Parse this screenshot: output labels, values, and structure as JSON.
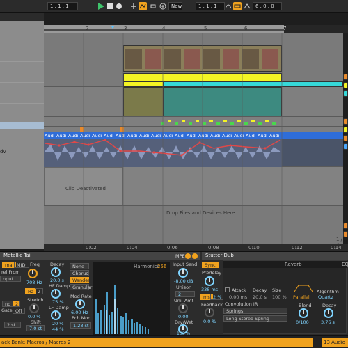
{
  "transport": {
    "arrangement_position": "1 .   1 .   1",
    "new_label": "New",
    "loop_start": "1 .   1 .   1",
    "loop_length": "6 .   0 .   0"
  },
  "ruler": {
    "bar_labels": [
      "2",
      "3",
      "4",
      "5",
      "6",
      "7"
    ]
  },
  "arrangement": {
    "clip_deactivated_label": "Clip Deactivated",
    "drop_label": "Drop Files and Devices Here",
    "audio_clip_label": "Audi",
    "audio_clip_labels": [
      "Audi",
      "Audi",
      "Audi",
      "Audi",
      "Audi",
      "Audi",
      "Audi",
      "Audi",
      "Audi",
      "Audi",
      "Audi",
      "Audi",
      "Audi",
      "Audi",
      "Audi",
      "Audi",
      "Audi",
      "Audi",
      "Audi",
      "Audi"
    ],
    "left_fragment_label": "dv",
    "zoom_fraction": "1 / 4",
    "timeline_labels": [
      "0:02",
      "0:04",
      "0:06",
      "0:08",
      "0:10",
      "0:12",
      "0:14"
    ],
    "track_colors": [
      "#f4f424",
      "#36d8d8",
      "#f4f424",
      "#e98a2b",
      "#4aa7ff",
      "#5a5a5a"
    ]
  },
  "device_metallic": {
    "title": "Metallic Tail",
    "mode_internal": "rnal",
    "mode_midi": "MIDI",
    "input_from_label": "rel From",
    "input_value": "nput",
    "freq_label": "Freq",
    "freq_value": "708 Hz",
    "mode_hz": "Hz",
    "mode_2": "2",
    "decay_label": "Decay",
    "decay_value": "20.0 s",
    "hf_damp_label": "HF Damp",
    "hf_damp_value": "75 %",
    "stretch_label": "Stretch",
    "stretch_value": "0.0 %",
    "lf_damp_label": "LF Damp",
    "lf_damp_value": "20 %",
    "shift_label": "Shift",
    "shift_value": "7.0 st",
    "mix_value": "44 %",
    "mono_label": "no",
    "gate_label": "Gate",
    "gate_value": "Off",
    "num_value": "2",
    "st_value": "2 st",
    "chorus_options": [
      "None",
      "Chorus",
      "Wander",
      "Granular"
    ],
    "mod_rate_label": "Mod Rate",
    "mod_rate_value": "6.00 Hz",
    "pch_mod_label": "Pch Mod",
    "pch_mod_value": "1.28 st",
    "harmonics_label": "Harmonics",
    "harmonics_value": "256"
  },
  "device_stutter": {
    "mpe_label": "MPE",
    "title": "Stutter Dub",
    "input_send_label": "Input Send",
    "input_send_value": "-8.00 dB",
    "unison_label": "Unison",
    "unison_value": "2",
    "uni_amt_label": "Uni. Amt",
    "uni_amt_value": "0.00",
    "dry_wet_label": "Dry/Wet",
    "dry_wet_value": "100 %",
    "sync_label": "Sync",
    "predelay_label": "Predelay",
    "predelay_value": "338 ms",
    "ms_label": "ms",
    "ms_value": "2 %",
    "feedback_label": "Feedback",
    "feedback_value": "0.0 %",
    "reverb_tab": "Reverb",
    "eq_tab": "EQ",
    "attack_label": "Attack",
    "attack_value": "0.00 ms",
    "rdecay_label": "Decay",
    "rdecay_value": "20.0 s",
    "size_label": "Size",
    "size_value": "100 %",
    "ir_label": "Convolution IR",
    "ir_category": "Springs",
    "ir_file": "Long Stereo Spring",
    "parallel_value": "Parallel",
    "algorithm_label": "Algorithm",
    "algorithm_value": "Quartz",
    "blend_label": "Blend",
    "blend_value": "0/100",
    "decay2_label": "Decay",
    "decay2_value": "3.76 s"
  },
  "status": {
    "breadcrumb": "ack Bank: Macros  /  Macros 2",
    "track_label": "13 Audio"
  }
}
